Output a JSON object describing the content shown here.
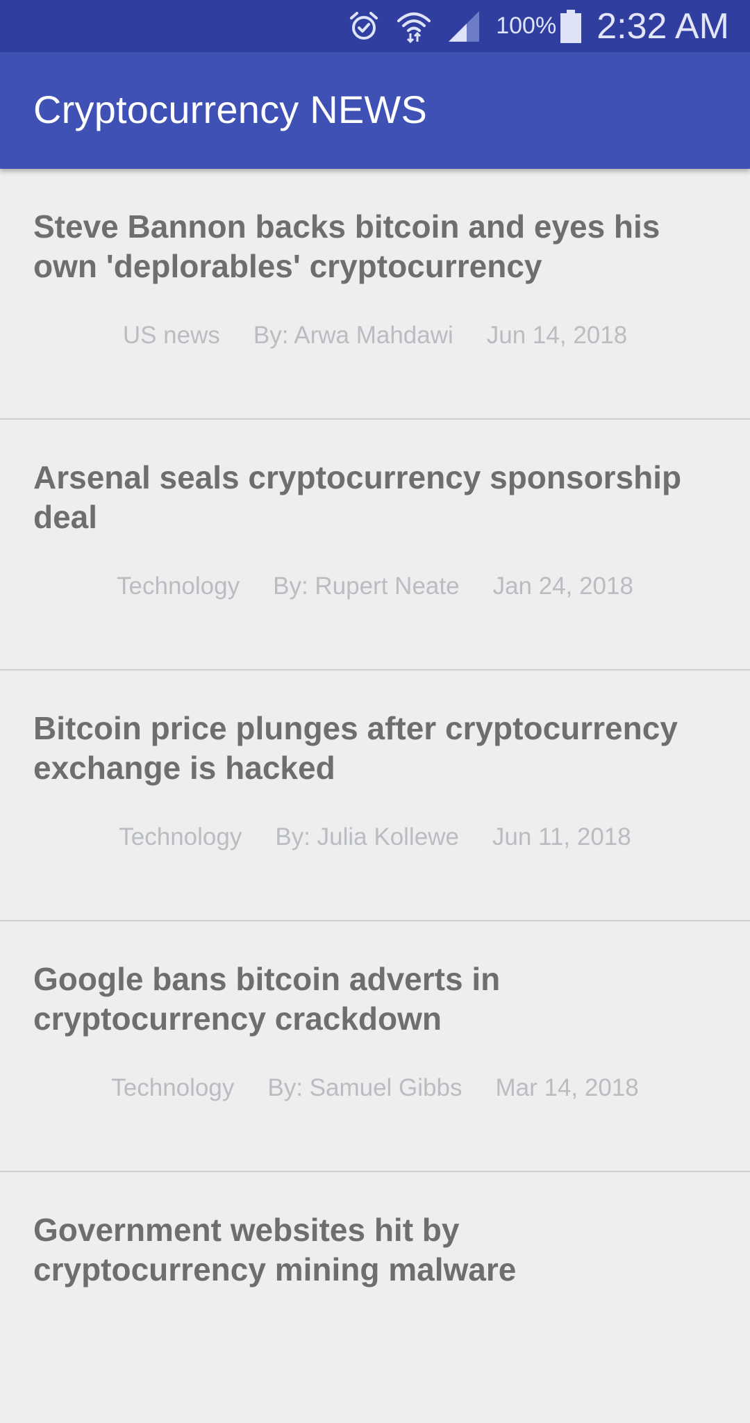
{
  "status_bar": {
    "battery_percent": "100%",
    "time": "2:32 AM",
    "icons": [
      "alarm-icon",
      "wifi-icon",
      "signal-icon",
      "battery-icon"
    ]
  },
  "app_bar": {
    "title": "Cryptocurrency NEWS"
  },
  "news": [
    {
      "title": "Steve Bannon backs bitcoin and eyes his own 'deplorables' cryptocurrency",
      "section": "US news",
      "author": "By: Arwa Mahdawi",
      "date": "Jun 14, 2018"
    },
    {
      "title": "Arsenal seals cryptocurrency sponsorship deal",
      "section": "Technology",
      "author": "By: Rupert Neate",
      "date": "Jan 24, 2018"
    },
    {
      "title": "Bitcoin price plunges after cryptocurrency exchange is hacked",
      "section": "Technology",
      "author": "By: Julia Kollewe",
      "date": "Jun 11, 2018"
    },
    {
      "title": "Google bans bitcoin adverts in cryptocurrency crackdown",
      "section": "Technology",
      "author": "By: Samuel Gibbs",
      "date": "Mar 14, 2018"
    },
    {
      "title": "Government websites hit by cryptocurrency mining malware"
    }
  ],
  "colors": {
    "status_bar": "#303f9f",
    "app_bar": "#3f51b5",
    "background": "#eeeeef",
    "title_text": "#6e6e6e",
    "meta_text": "#b9bcc1"
  }
}
